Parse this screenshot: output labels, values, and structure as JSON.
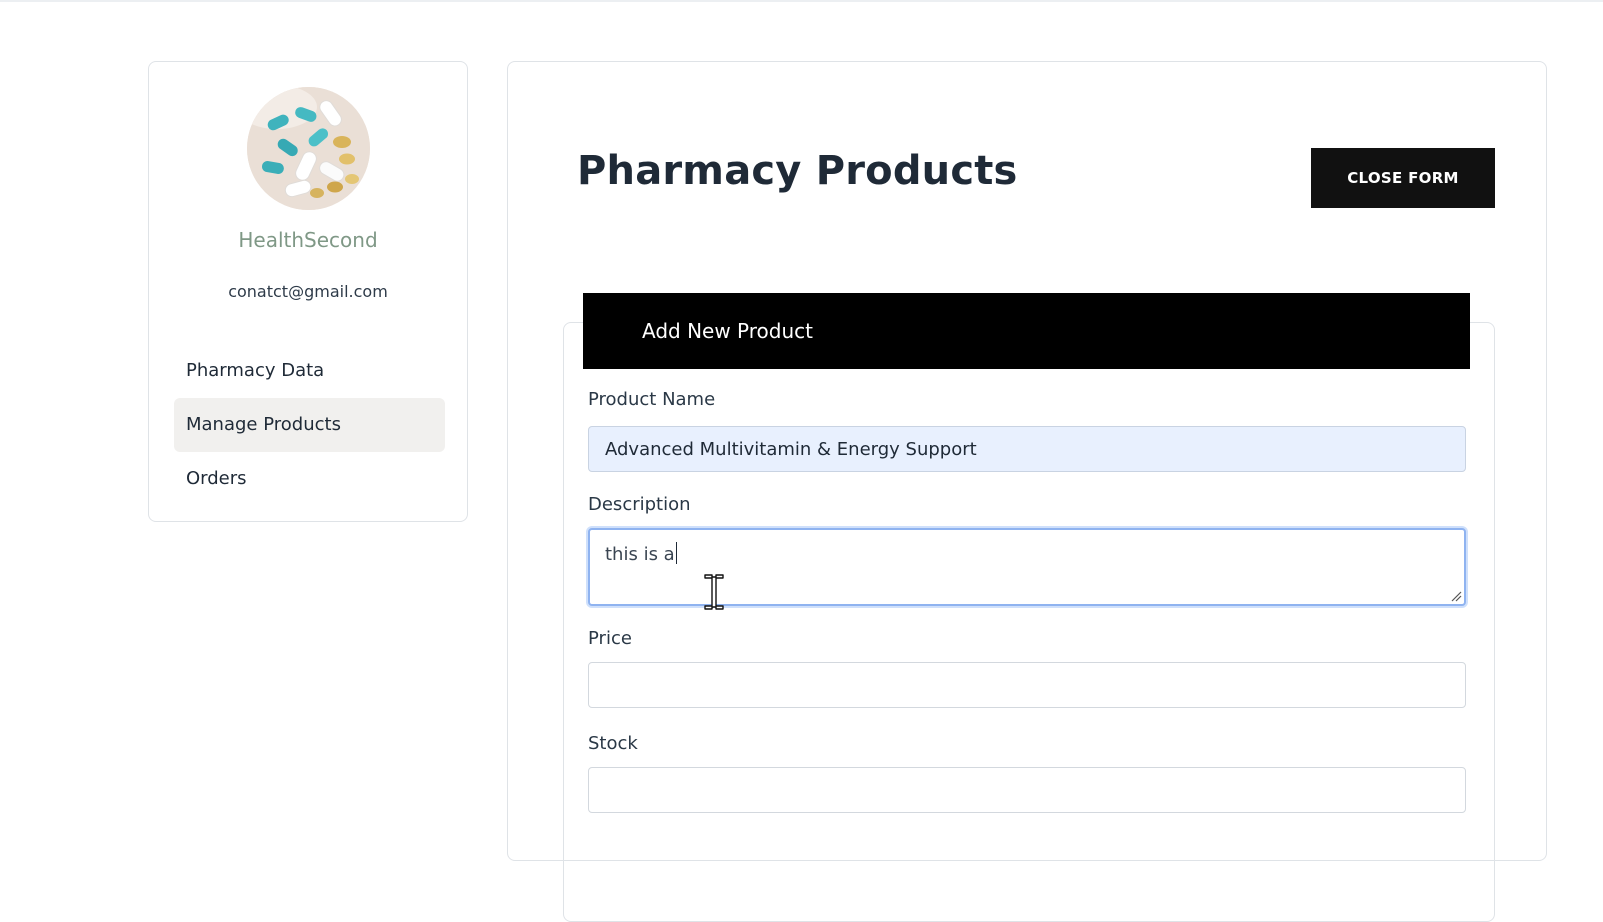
{
  "sidebar": {
    "store_name": "HealthSecond",
    "email": "conatct@gmail.com",
    "items": [
      {
        "label": "Pharmacy Data",
        "active": false
      },
      {
        "label": "Manage Products",
        "active": true
      },
      {
        "label": "Orders",
        "active": false
      }
    ]
  },
  "main": {
    "title": "Pharmacy Products",
    "close_button_label": "CLOSE FORM",
    "form": {
      "header": "Add New Product",
      "fields": {
        "product_name": {
          "label": "Product Name",
          "value": "Advanced Multivitamin & Energy Support"
        },
        "description": {
          "label": "Description",
          "value": "this is a"
        },
        "price": {
          "label": "Price",
          "value": ""
        },
        "stock": {
          "label": "Stock",
          "value": ""
        }
      }
    }
  },
  "colors": {
    "header_bg": "#000000",
    "button_bg": "#111111",
    "autofill_bg": "#e8f0fe",
    "focus_border": "#8fb3f0",
    "store_name": "#7f9886",
    "active_nav_bg": "#f1f0ee"
  },
  "icons": {
    "cursor": "i-beam-cursor-icon",
    "resize": "resize-handle-icon"
  }
}
